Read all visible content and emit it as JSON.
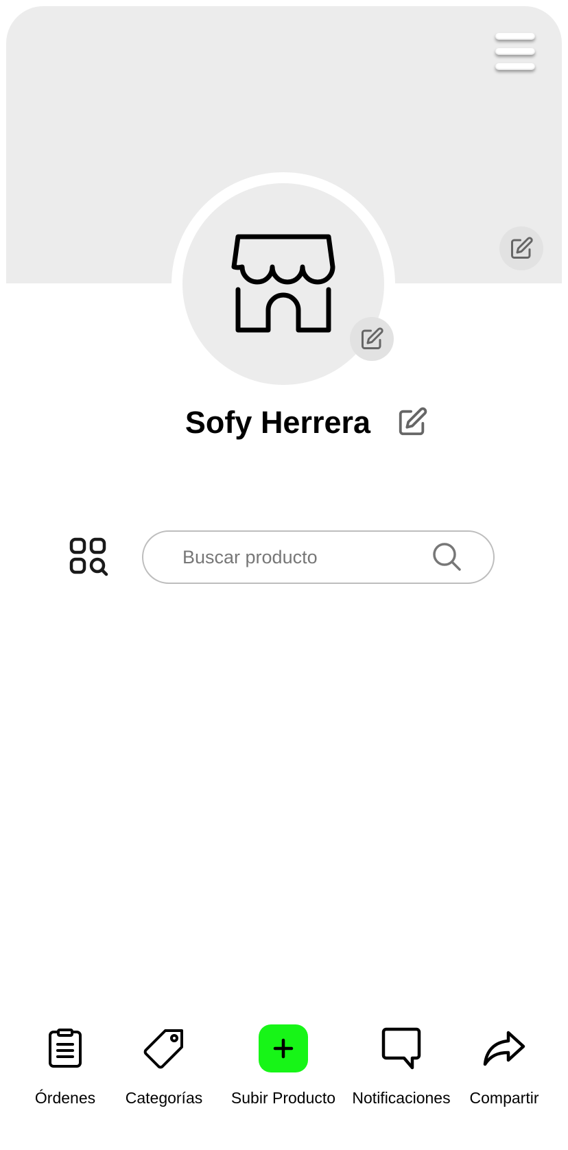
{
  "profile": {
    "name": "Sofy Herrera"
  },
  "search": {
    "placeholder": "Buscar producto"
  },
  "nav": {
    "items": [
      {
        "label": "Órdenes",
        "icon": "clipboard-list-icon"
      },
      {
        "label": "Categorías",
        "icon": "tag-icon"
      },
      {
        "label": "Subir Producto",
        "icon": "plus-icon"
      },
      {
        "label": "Notificaciones",
        "icon": "speech-bubble-icon"
      },
      {
        "label": "Compartir",
        "icon": "share-arrow-icon"
      }
    ]
  },
  "colors": {
    "cover_background": "#ececec",
    "avatar_background": "#ececec",
    "accent_green": "#17f517",
    "edit_button_background": "#e2e2e2"
  },
  "icons": {
    "menu": "hamburger-menu-icon",
    "edit": "pencil-edit-icon",
    "store": "storefront-icon",
    "category_search": "grid-search-icon",
    "search": "magnifier-icon"
  }
}
